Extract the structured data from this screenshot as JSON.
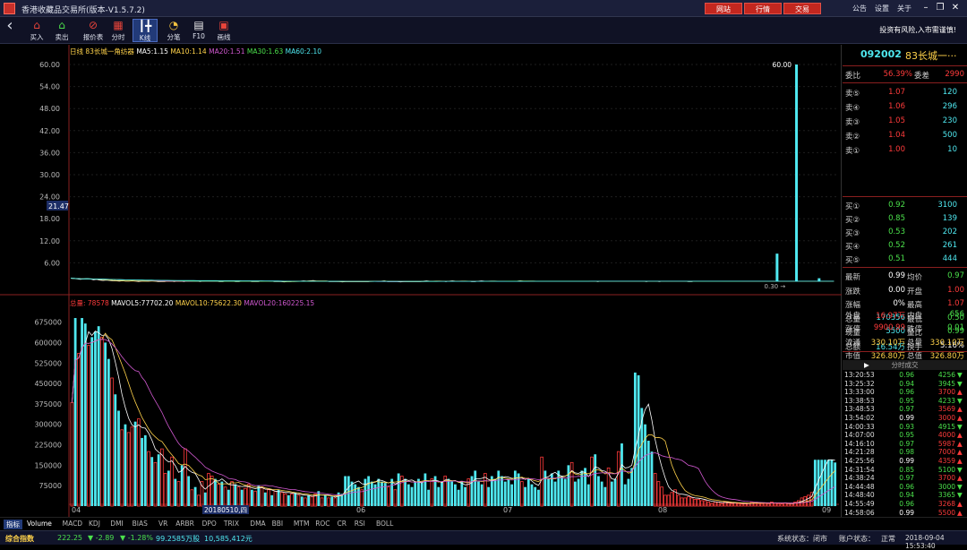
{
  "window": {
    "title": "香港收藏品交易所(版本-V1.5.7.2)"
  },
  "topbar": {
    "buttons": [
      "网站",
      "行情",
      "交易"
    ],
    "links": [
      "公告",
      "设置",
      "关于"
    ]
  },
  "toolbar": {
    "items": [
      {
        "label": "买入",
        "icon": "buy-house-icon"
      },
      {
        "label": "卖出",
        "icon": "sell-house-icon"
      },
      {
        "label": "报价表",
        "icon": "quote-table-icon"
      },
      {
        "label": "分时",
        "icon": "time-share-icon"
      },
      {
        "label": "K线",
        "icon": "candlestick-icon"
      },
      {
        "label": "分笔",
        "icon": "pie-tick-icon"
      },
      {
        "label": "F10",
        "icon": "f10-doc-icon"
      },
      {
        "label": "画线",
        "icon": "draw-line-icon"
      }
    ],
    "notice": "投资有风险,入市需谨慎!"
  },
  "legend_price": {
    "period": "日线",
    "name": "83长城一角纺器",
    "ma5": "MA5:1.15",
    "ma10": "MA10:1.14",
    "ma20": "MA20:1.51",
    "ma30": "MA30:1.63",
    "ma60": "MA60:2.10"
  },
  "legend_vol": {
    "total": "总量: 78578",
    "mavol5": "MAVOL5:77702.20",
    "mavol10": "MAVOL10:75622.30",
    "mavol20": "MAVOL20:160225.15"
  },
  "chart_data": [
    {
      "type": "line",
      "title": "日线 83长城一角纺器",
      "yticks": [
        "60.00",
        "54.00",
        "48.00",
        "42.00",
        "36.00",
        "30.00",
        "24.00",
        "18.00",
        "12.00",
        "6.00"
      ],
      "ylim": [
        0,
        60
      ],
      "cursor_value": "21.47",
      "peak_label": "60.00",
      "low_label": "0.30",
      "close": [
        1.8,
        1.7,
        1.6,
        1.5,
        1.6,
        1.7,
        1.6,
        1.4,
        1.5,
        1.3,
        1.2,
        1.3,
        1.2,
        1.1,
        1.1,
        1.0,
        1.1,
        1.0,
        1.0,
        1.1,
        1.0,
        0.9,
        1.0,
        1.0,
        1.0,
        1.1,
        1.0,
        0.9,
        0.9,
        0.9,
        1.0,
        1.0,
        0.9,
        1.0,
        1.0,
        0.9,
        1.0,
        1.0,
        1.0,
        1.0,
        0.9,
        1.0,
        1.1,
        1.0,
        1.0,
        1.0,
        0.9,
        0.9,
        1.0,
        1.0,
        1.0,
        0.9,
        0.9,
        1.0,
        1.0,
        1.0,
        0.9,
        0.9,
        0.9,
        1.0,
        1.0,
        1.0,
        1.0,
        0.9,
        0.9,
        0.9,
        0.8,
        0.9,
        0.9,
        1.0,
        1.0,
        1.0,
        1.1,
        1.0,
        1.1,
        1.2,
        1.0,
        1.0,
        1.0,
        1.0,
        0.9,
        0.9,
        0.9,
        0.9,
        0.8,
        0.9,
        0.9,
        0.9,
        0.9,
        0.9,
        0.9,
        0.9,
        0.9,
        1.0,
        1.0,
        1.0,
        1.0,
        1.1,
        0.9,
        0.9,
        0.9,
        0.9,
        0.8,
        0.9,
        0.9,
        0.9,
        0.9,
        0.9,
        0.9,
        1.0,
        1.1,
        1.0,
        1.0,
        1.0,
        1.0,
        1.0,
        0.9,
        1.0,
        1.1,
        1.0,
        1.0,
        1.0,
        1.0,
        1.0,
        0.9,
        0.9,
        1.0,
        1.1,
        1.0,
        1.0,
        1.0,
        1.0,
        1.0,
        1.0,
        1.0,
        1.0,
        1.0,
        1.0,
        1.0,
        1.1,
        1.0,
        1.0,
        1.0,
        1.0,
        1.0,
        1.0,
        1.0,
        1.0,
        1.0,
        1.0,
        1.0,
        1.0,
        1.0,
        1.0,
        1.0,
        1.0,
        1.0,
        1.0,
        1.0,
        1.0,
        1.0,
        1.0,
        1.0,
        0.9,
        1.0,
        1.0,
        1.0,
        1.0,
        1.0,
        1.0,
        1.0,
        1.0,
        1.0,
        1.0,
        1.0,
        1.0,
        1.0,
        1.0,
        0.9,
        1.0,
        1.0,
        1.0,
        0.9,
        1.0,
        1.0,
        1.0,
        1.0,
        1.0,
        1.0,
        1.0,
        1.0,
        0.9,
        0.9,
        1.0,
        1.0,
        1.0,
        1.0,
        1.0,
        1.0,
        1.0,
        1.0,
        1.0,
        1.0,
        1.0,
        1.0,
        1.0,
        1.0,
        1.0,
        1.0,
        1.0,
        1.0,
        1.0,
        1.0,
        1.0,
        1.0,
        1.0,
        1.0,
        1.0,
        1.0,
        1.0,
        1.0,
        1.0,
        1.0,
        1.0,
        1.0,
        1.0,
        1.0,
        1.0,
        1.0,
        1.0,
        1.0,
        1.0,
        1.0,
        1.0,
        1.0,
        1.0,
        0.99
      ],
      "spikes": [
        {
          "index": 218,
          "high": 8.5
        },
        {
          "index": 224,
          "high": 60.0
        },
        {
          "index": 231,
          "high": 1.8
        }
      ]
    },
    {
      "type": "bar",
      "title": "总量",
      "yticks": [
        "675000",
        "600000",
        "525000",
        "450000",
        "375000",
        "300000",
        "225000",
        "150000",
        "75000"
      ],
      "ylim": [
        0,
        700000
      ],
      "xlabels": [
        "04",
        "20180510,四",
        "06",
        "07",
        "08",
        "09"
      ],
      "volume": [
        380000,
        690000,
        560000,
        690000,
        670000,
        590000,
        620000,
        640000,
        660000,
        620000,
        600000,
        540000,
        470000,
        410000,
        350000,
        280000,
        300000,
        270000,
        290000,
        310000,
        320000,
        250000,
        260000,
        200000,
        180000,
        160000,
        190000,
        210000,
        120000,
        130000,
        180000,
        100000,
        90000,
        150000,
        210000,
        110000,
        60000,
        70000,
        40000,
        90000,
        50000,
        120000,
        110000,
        100000,
        80000,
        90000,
        70000,
        60000,
        90000,
        80000,
        70000,
        60000,
        65000,
        80000,
        60000,
        55000,
        75000,
        70000,
        50000,
        60000,
        40000,
        55000,
        60000,
        50000,
        45000,
        40000,
        45000,
        50000,
        40000,
        35000,
        30000,
        40000,
        35000,
        45000,
        55000,
        30000,
        40000,
        30000,
        35000,
        30000,
        50000,
        45000,
        110000,
        110000,
        90000,
        80000,
        70000,
        60000,
        100000,
        110000,
        90000,
        80000,
        100000,
        90000,
        85000,
        70000,
        100000,
        60000,
        120000,
        110000,
        100000,
        80000,
        70000,
        90000,
        100000,
        85000,
        120000,
        60000,
        100000,
        110000,
        70000,
        90000,
        110000,
        100000,
        90000,
        80000,
        60000,
        90000,
        70000,
        100000,
        110000,
        130000,
        90000,
        80000,
        120000,
        70000,
        110000,
        100000,
        130000,
        110000,
        90000,
        100000,
        80000,
        130000,
        120000,
        90000,
        70000,
        100000,
        80000,
        70000,
        60000,
        180000,
        130000,
        100000,
        120000,
        90000,
        130000,
        110000,
        100000,
        150000,
        160000,
        90000,
        100000,
        130000,
        140000,
        80000,
        180000,
        190000,
        110000,
        90000,
        70000,
        140000,
        90000,
        100000,
        200000,
        230000,
        80000,
        100000,
        140000,
        490000,
        480000,
        360000,
        300000,
        240000,
        200000,
        120000,
        90000,
        70000,
        40000,
        40000,
        50000,
        60000,
        40000,
        30000,
        30000,
        35000,
        30000,
        25000,
        25000,
        20000,
        20000,
        15000,
        10000,
        15000,
        15000,
        10000,
        15000,
        12000,
        10000,
        12000,
        10000,
        8000,
        10000,
        10000,
        15000,
        12000,
        10000,
        10000,
        12000,
        10000,
        15000,
        12000,
        10000,
        8000,
        12000,
        10000,
        10000,
        15000,
        20000,
        30000,
        35000,
        40000,
        50000,
        170000,
        170000,
        170000,
        170000,
        170000,
        170000,
        160000
      ],
      "up": [
        1,
        0,
        1,
        0,
        0,
        1,
        0,
        0,
        0,
        1,
        0,
        0,
        1,
        0,
        0,
        1,
        0,
        1,
        1,
        0,
        1,
        0,
        0,
        1,
        0,
        1,
        0,
        1,
        1,
        0,
        1,
        0,
        1,
        0,
        1,
        0,
        1,
        0,
        1,
        1,
        0,
        1,
        1,
        0,
        1,
        0,
        1,
        0,
        1,
        0,
        1,
        0,
        1,
        1,
        0,
        1,
        0,
        1,
        0,
        1,
        0,
        1,
        0,
        1,
        1,
        0,
        1,
        0,
        1,
        0,
        1,
        0,
        1,
        1,
        0,
        1,
        0,
        1,
        0,
        1,
        0,
        0,
        0,
        0,
        0,
        0,
        0,
        1,
        0,
        0,
        0,
        0,
        0,
        0,
        0,
        1,
        0,
        1,
        0,
        1,
        0,
        0,
        0,
        0,
        0,
        0,
        0,
        0,
        1,
        0,
        0,
        0,
        1,
        0,
        0,
        0,
        0,
        0,
        0,
        1,
        0,
        0,
        0,
        0,
        1,
        0,
        0,
        0,
        0,
        0,
        0,
        0,
        0,
        0,
        0,
        1,
        0,
        0,
        0,
        0,
        0,
        1,
        0,
        0,
        0,
        0,
        0,
        0,
        0,
        0,
        1,
        0,
        0,
        0,
        0,
        0,
        1,
        0,
        0,
        0,
        0,
        1,
        0,
        0,
        1,
        0,
        0,
        0,
        0,
        0,
        0,
        0,
        0,
        0,
        0,
        1,
        1,
        1,
        1,
        1,
        1,
        1,
        1,
        1,
        1,
        1,
        1,
        1,
        1,
        1,
        1,
        1,
        1,
        1,
        1,
        1,
        1,
        1,
        1,
        1,
        1,
        1,
        1,
        1,
        1,
        1,
        1,
        1,
        1,
        1,
        1,
        1,
        1,
        1,
        1,
        1,
        1,
        1,
        1,
        1,
        1,
        1,
        1,
        1,
        1,
        1,
        1,
        1,
        1,
        1,
        1,
        1,
        1,
        1,
        1,
        1,
        1,
        1,
        1,
        1,
        1,
        1,
        1
      ]
    }
  ],
  "stock": {
    "code": "092002",
    "name": "83长城一···"
  },
  "order_book": {
    "ratio_label": "委比",
    "ratio": "56.39%",
    "diff_label": "委差",
    "diff": "2990",
    "asks": [
      {
        "label": "卖⑤",
        "price": "1.07",
        "vol": "120"
      },
      {
        "label": "卖④",
        "price": "1.06",
        "vol": "296"
      },
      {
        "label": "卖③",
        "price": "1.05",
        "vol": "230"
      },
      {
        "label": "卖②",
        "price": "1.04",
        "vol": "500"
      },
      {
        "label": "卖①",
        "price": "1.00",
        "vol": "10"
      }
    ],
    "bids": [
      {
        "label": "买①",
        "price": "0.92",
        "vol": "3100"
      },
      {
        "label": "买②",
        "price": "0.85",
        "vol": "139"
      },
      {
        "label": "买③",
        "price": "0.53",
        "vol": "202"
      },
      {
        "label": "买④",
        "price": "0.52",
        "vol": "261"
      },
      {
        "label": "买⑤",
        "price": "0.51",
        "vol": "444"
      }
    ]
  },
  "stats": [
    {
      "l1": "最新",
      "v1": "0.99",
      "c1": "#ffffff",
      "l2": "均价",
      "v2": "0.97",
      "c2": "#4be04b"
    },
    {
      "l1": "涨跌",
      "v1": "0.00",
      "c1": "#ffffff",
      "l2": "开盘",
      "v2": "1.00",
      "c2": "#ff3b3b"
    },
    {
      "l1": "涨幅",
      "v1": "0%",
      "c1": "#ffffff",
      "l2": "最高",
      "v2": "1.07",
      "c2": "#ff3b3b"
    },
    {
      "l1": "总量",
      "v1": "170356",
      "c1": "#4fe8f0",
      "l2": "最低",
      "v2": "0.50",
      "c2": "#4be04b"
    },
    {
      "l1": "现量",
      "v1": "5500",
      "c1": "#4fe8f0",
      "l2": "量比",
      "v2": "0.99",
      "c2": "#4be04b"
    },
    {
      "l1": "总额",
      "v1": "16.54万",
      "c1": "#4fe8f0",
      "l2": "换手",
      "v2": "5.16%",
      "c2": "#ffffff"
    }
  ],
  "stats2": [
    {
      "l1": "外盘",
      "v1": "16.97万",
      "c1": "#ff3b3b",
      "l2": "内盘",
      "v2": "656",
      "c2": "#4be04b"
    },
    {
      "l1": "涨停",
      "v1": "9900.99",
      "c1": "#ff3b3b",
      "l2": "跌停",
      "v2": "0.01",
      "c2": "#4be04b"
    }
  ],
  "stats3": [
    {
      "l1": "流通",
      "v1": "330.10万",
      "c1": "#ffd24a",
      "l2": "总量",
      "v2": "330.10万",
      "c2": "#ffd24a"
    },
    {
      "l1": "市值",
      "v1": "326.80万",
      "c1": "#ffd24a",
      "l2": "总值",
      "v2": "326.80万",
      "c2": "#ffd24a"
    }
  ],
  "trades": {
    "header": "分时成交",
    "rows": [
      {
        "t": "13:20:53",
        "p": "0.96",
        "v": "4256",
        "d": "down"
      },
      {
        "t": "13:25:32",
        "p": "0.94",
        "v": "3945",
        "d": "down"
      },
      {
        "t": "13:33:00",
        "p": "0.96",
        "v": "3700",
        "d": "up"
      },
      {
        "t": "13:38:53",
        "p": "0.95",
        "v": "4233",
        "d": "down"
      },
      {
        "t": "13:48:53",
        "p": "0.97",
        "v": "3569",
        "d": "up"
      },
      {
        "t": "13:54:02",
        "p": "0.99",
        "v": "3000",
        "d": "up"
      },
      {
        "t": "14:00:33",
        "p": "0.93",
        "v": "4915",
        "d": "down"
      },
      {
        "t": "14:07:00",
        "p": "0.95",
        "v": "4000",
        "d": "up"
      },
      {
        "t": "14:16:10",
        "p": "0.97",
        "v": "5987",
        "d": "up"
      },
      {
        "t": "14:21:28",
        "p": "0.98",
        "v": "7000",
        "d": "up"
      },
      {
        "t": "14:25:56",
        "p": "0.99",
        "v": "4359",
        "d": "up"
      },
      {
        "t": "14:31:54",
        "p": "0.85",
        "v": "5100",
        "d": "down"
      },
      {
        "t": "14:38:24",
        "p": "0.97",
        "v": "3700",
        "d": "up"
      },
      {
        "t": "14:44:48",
        "p": "0.96",
        "v": "3000",
        "d": "down"
      },
      {
        "t": "14:48:40",
        "p": "0.94",
        "v": "3365",
        "d": "down"
      },
      {
        "t": "14:55:49",
        "p": "0.96",
        "v": "3268",
        "d": "up"
      },
      {
        "t": "14:58:06",
        "p": "0.99",
        "v": "5500",
        "d": "up"
      }
    ]
  },
  "tabs": [
    "指标",
    "Volume",
    "MACD",
    "KDJ",
    "DMI",
    "BIAS",
    "VR",
    "ARBR",
    "DPO",
    "TRIX",
    "DMA",
    "BBI",
    "MTM",
    "ROC",
    "CR",
    "RSI",
    "BOLL"
  ],
  "status": {
    "index_name": "综合指数",
    "index_value": "222.25",
    "change": "▼ -2.89",
    "change_pct": "▼ -1.28%",
    "volume": "99.2585万股",
    "amount": "10,585,412元",
    "sys_label": "系统状态：",
    "sys_value": "闭市",
    "acct_label": "账户状态：",
    "acct_value": "正常",
    "datetime": "2018-09-04 15:53:40"
  },
  "colors": {
    "up": "#ff3b3b",
    "down": "#4fe8f0",
    "ma5": "#ffffff",
    "ma10": "#ffd24a",
    "ma20": "#d058d0",
    "ma30": "#4be04b",
    "ma60": "#ff8c00"
  }
}
